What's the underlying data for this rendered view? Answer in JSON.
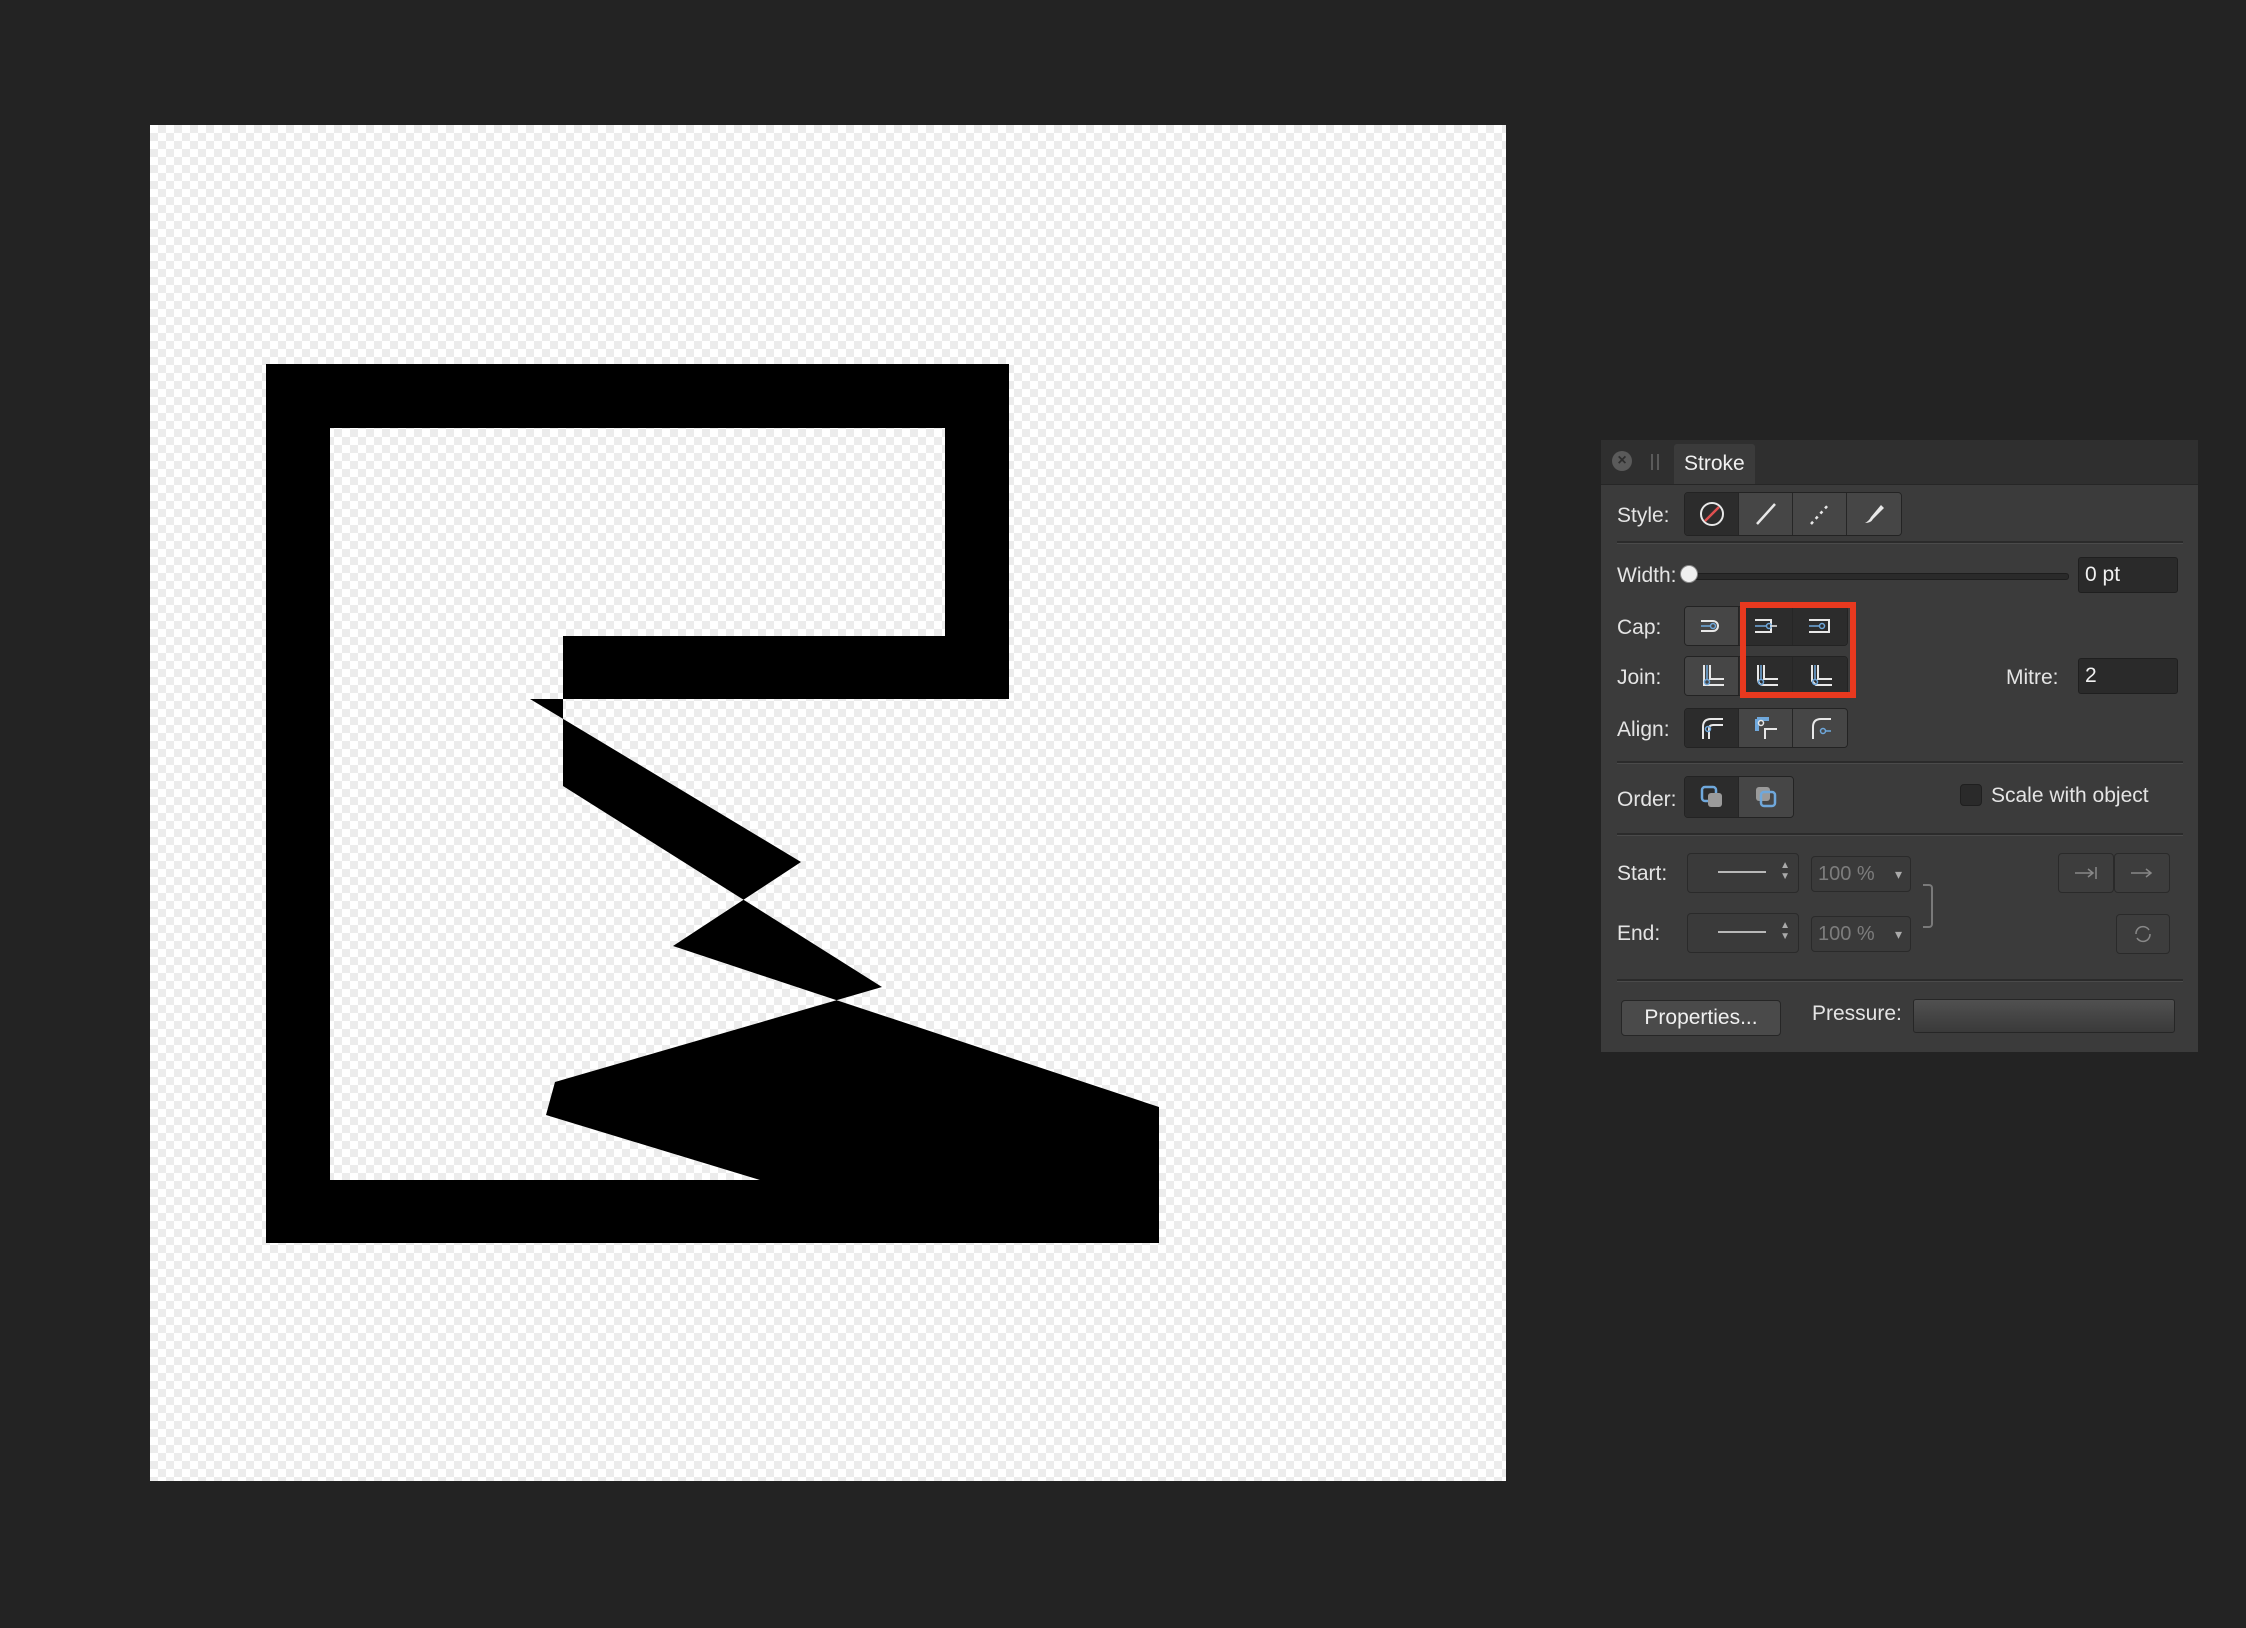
{
  "panel": {
    "tab_title": "Stroke",
    "style_label": "Style:",
    "width_label": "Width:",
    "width_value": "0 pt",
    "cap_label": "Cap:",
    "join_label": "Join:",
    "mitre_label": "Mitre:",
    "mitre_value": "2",
    "align_label": "Align:",
    "order_label": "Order:",
    "scale_label": "Scale with object",
    "start_label": "Start:",
    "end_label": "End:",
    "start_percent": "100 %",
    "end_percent": "100 %",
    "properties_label": "Properties...",
    "pressure_label": "Pressure:"
  },
  "icons": {
    "style": [
      "no-stroke-icon",
      "solid-line-icon",
      "dashed-line-icon",
      "brush-icon"
    ],
    "cap": [
      "butt-cap-icon",
      "round-cap-icon",
      "square-cap-icon"
    ],
    "join": [
      "mitre-join-icon",
      "round-join-icon",
      "bevel-join-icon"
    ],
    "align": [
      "align-center-icon",
      "align-inside-icon",
      "align-outside-icon"
    ],
    "order": [
      "stroke-behind-fill-icon",
      "stroke-in-front-icon"
    ]
  },
  "colors": {
    "accent": "#6fa8dc",
    "highlight": "#e8391f",
    "no_stroke": "#e05050"
  }
}
